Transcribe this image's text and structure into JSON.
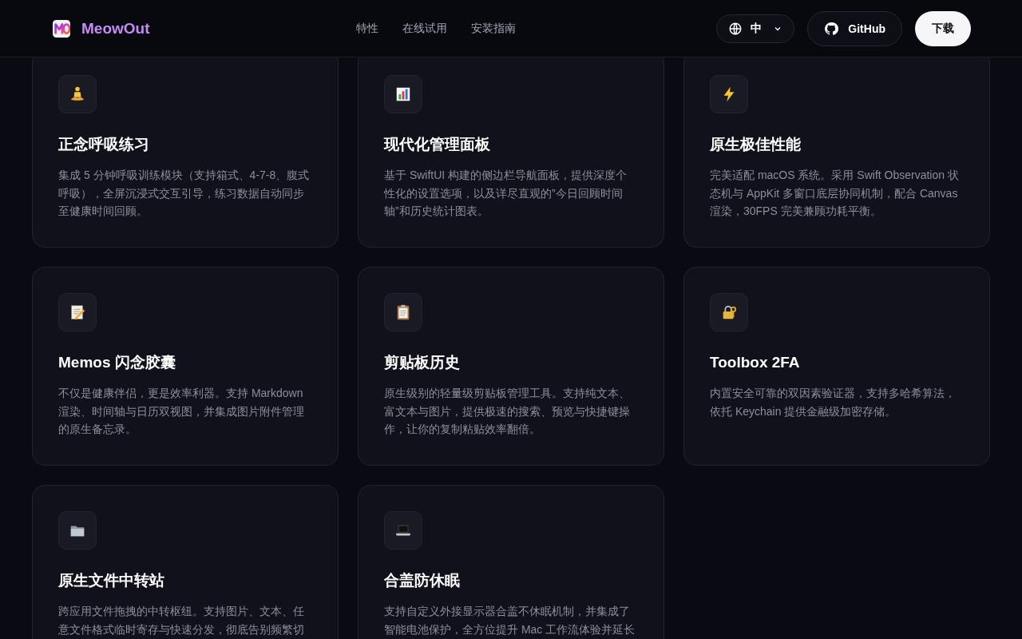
{
  "header": {
    "brand": "MeowOut",
    "nav": [
      {
        "label": "特性"
      },
      {
        "label": "在线试用"
      },
      {
        "label": "安装指南"
      }
    ],
    "language": {
      "label": "中"
    },
    "github": {
      "label": "GitHub"
    },
    "download": {
      "label": "下载"
    }
  },
  "features": [
    {
      "title": "正念呼吸练习",
      "description": "集成 5 分钟呼吸训练模块（支持箱式、4-7-8、腹式呼吸），全屏沉浸式交互引导，练习数据自动同步至健康时间回顾。"
    },
    {
      "title": "现代化管理面板",
      "description": "基于 SwiftUI 构建的侧边栏导航面板，提供深度个性化的设置选项，以及详尽直观的”今日回顾时间轴”和历史统计图表。"
    },
    {
      "title": "原生极佳性能",
      "description": "完美适配 macOS 系统。采用 Swift Observation 状态机与 AppKit 多窗口底层协同机制，配合 Canvas 渲染，30FPS 完美兼顾功耗平衡。"
    },
    {
      "title": "Memos 闪念胶囊",
      "description": "不仅是健康伴侣，更是效率利器。支持 Markdown 渲染、时间轴与日历双视图，并集成图片附件管理的原生备忘录。"
    },
    {
      "title": "剪贴板历史",
      "description": "原生级别的轻量级剪贴板管理工具。支持纯文本、富文本与图片，提供极速的搜索、预览与快捷键操作，让你的复制粘贴效率翻倍。"
    },
    {
      "title": "Toolbox 2FA",
      "description": "内置安全可靠的双因素验证器，支持多哈希算法，依托 Keychain 提供金融级加密存储。"
    },
    {
      "title": "原生文件中转站",
      "description": "跨应用文件拖拽的中转枢纽。支持图片、文本、任意文件格式临时寄存与快速分发，彻底告别频繁切"
    },
    {
      "title": "合盖防休眠",
      "description": "支持自定义外接显示器合盖不休眠机制，并集成了智能电池保护，全方位提升 Mac 工作流体验并延长"
    }
  ]
}
